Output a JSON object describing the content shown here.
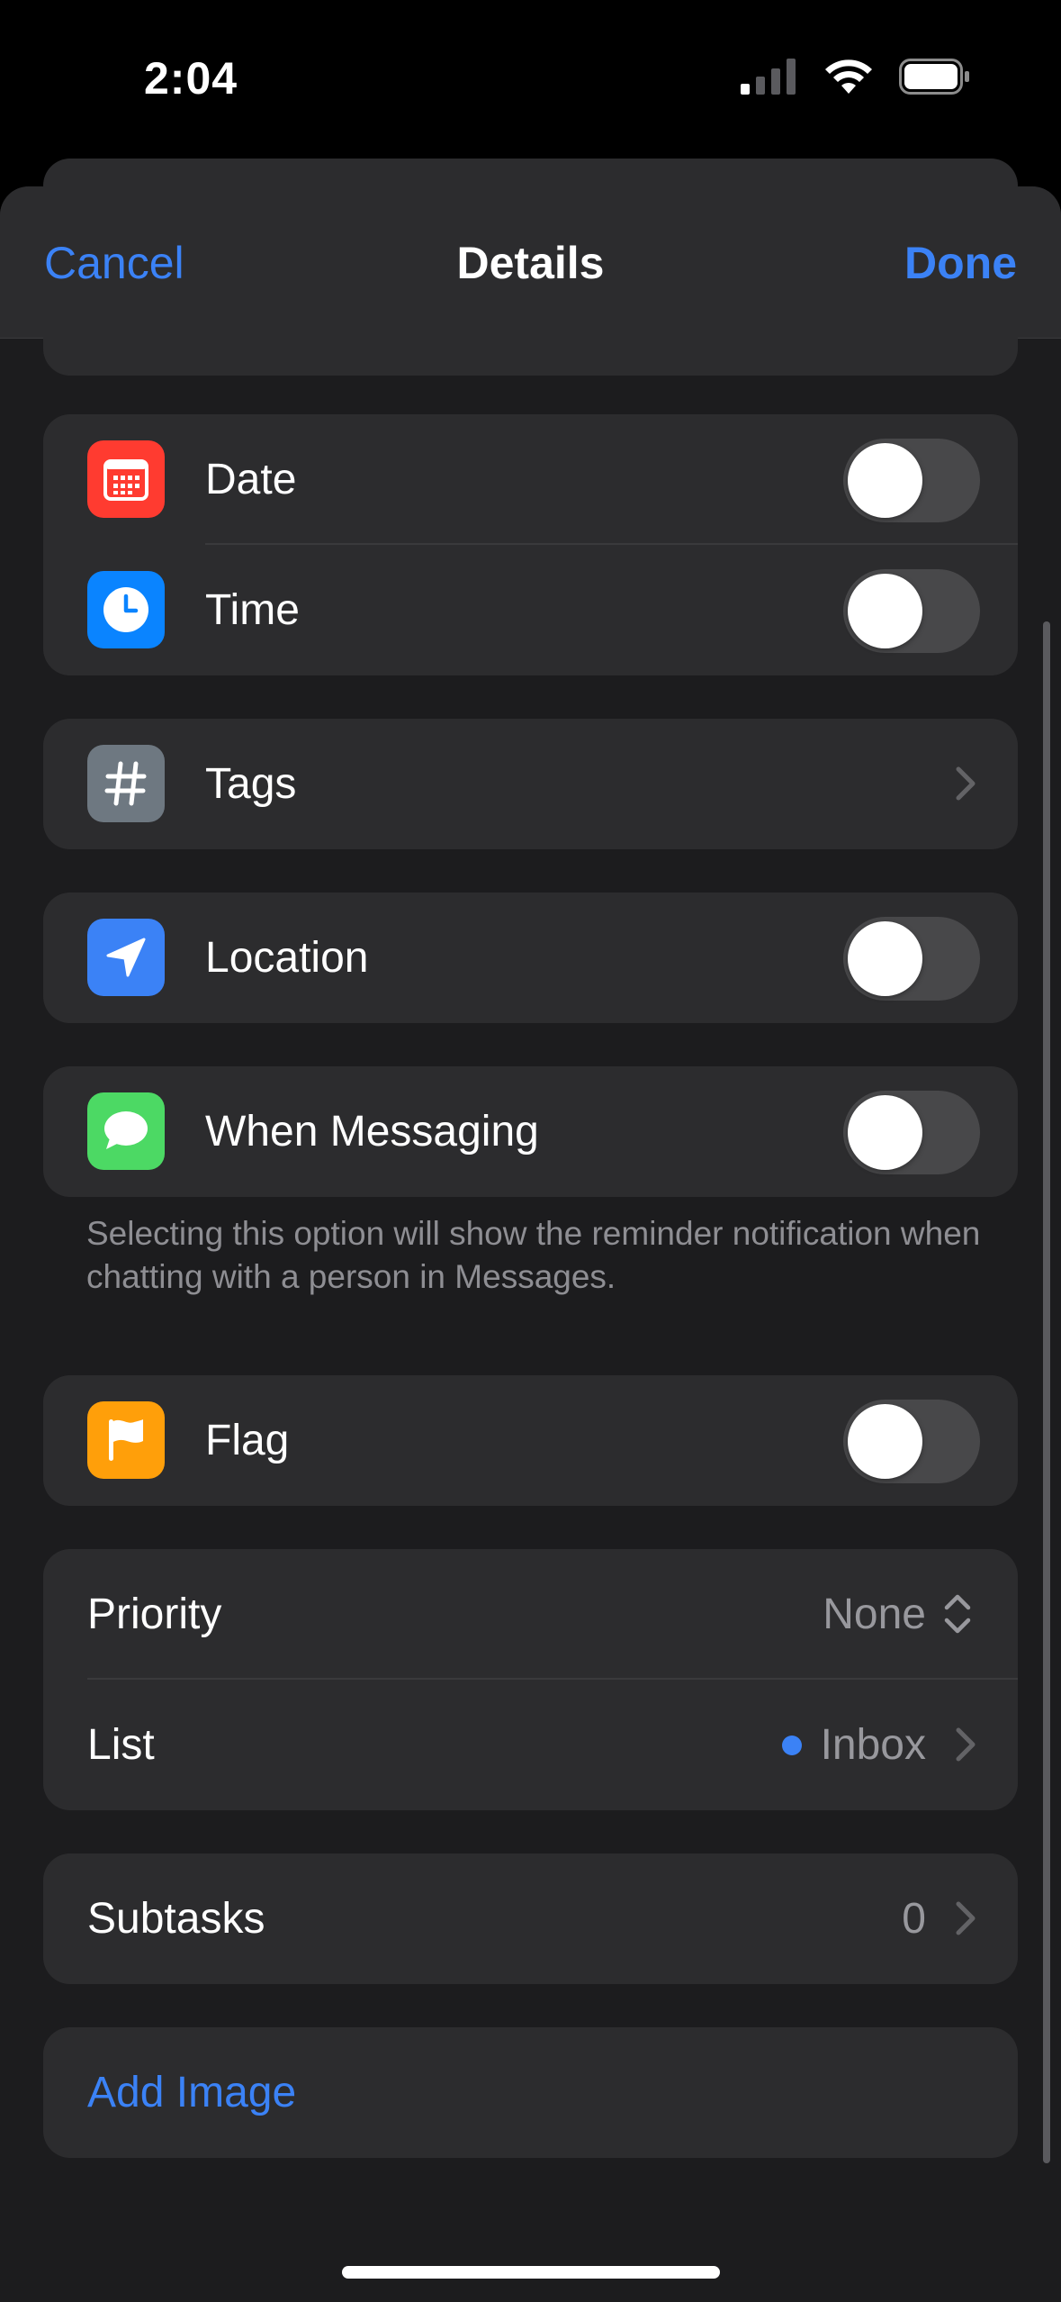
{
  "status_bar": {
    "time": "2:04",
    "icons": [
      "cellular-signal-icon",
      "wifi-icon",
      "battery-icon"
    ]
  },
  "nav": {
    "cancel": "Cancel",
    "title": "Details",
    "done": "Done"
  },
  "groups": {
    "date_time": {
      "date": {
        "label": "Date",
        "icon": "calendar-icon",
        "icon_color": "#ff3b30",
        "toggle_on": false
      },
      "time": {
        "label": "Time",
        "icon": "clock-icon",
        "icon_color": "#0a84ff",
        "toggle_on": false
      }
    },
    "tags": {
      "label": "Tags",
      "icon": "hashtag-icon",
      "icon_color": "#6e7881"
    },
    "location": {
      "label": "Location",
      "icon": "location-arrow-icon",
      "icon_color": "#3b82f6",
      "toggle_on": false
    },
    "messaging": {
      "label": "When Messaging",
      "icon": "message-bubble-icon",
      "icon_color": "#4cd964",
      "toggle_on": false,
      "footnote": "Selecting this option will show the reminder notification when chatting with a person in Messages."
    },
    "flag": {
      "label": "Flag",
      "icon": "flag-icon",
      "icon_color": "#ff9f0a",
      "toggle_on": false
    },
    "priority_list": {
      "priority": {
        "label": "Priority",
        "value": "None"
      },
      "list": {
        "label": "List",
        "value": "Inbox",
        "dot_color": "#3b82f6"
      }
    },
    "subtasks": {
      "label": "Subtasks",
      "count": "0"
    },
    "add_image": {
      "label": "Add Image"
    }
  },
  "colors": {
    "accent": "#3b82f6",
    "background": "#1c1c1e",
    "cell": "#2c2c2e",
    "secondary_text": "#8e8e93"
  }
}
